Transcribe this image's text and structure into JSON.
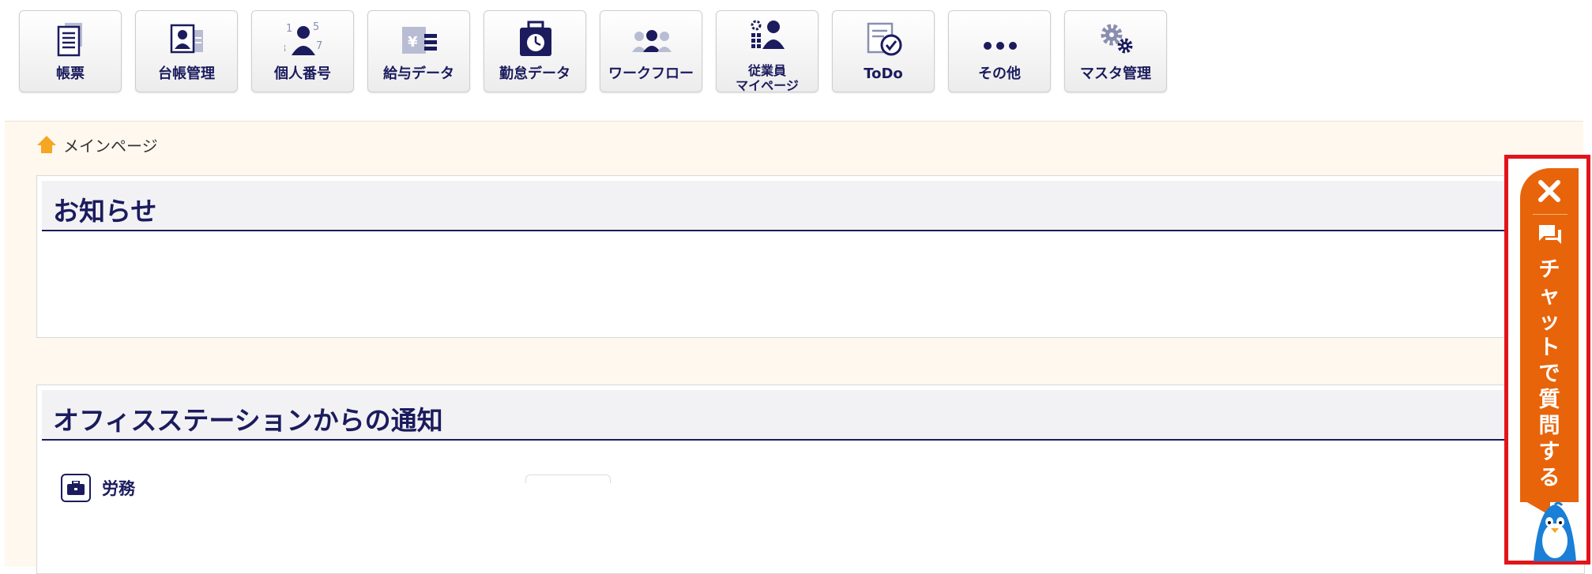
{
  "toolbar": {
    "items": [
      {
        "label": "帳票",
        "icon": "document-list-icon"
      },
      {
        "label": "台帳管理",
        "icon": "id-card-icon"
      },
      {
        "label": "個人番号",
        "icon": "person-number-icon"
      },
      {
        "label": "給与データ",
        "icon": "yen-envelope-icon"
      },
      {
        "label": "勤怠データ",
        "icon": "clock-bag-icon"
      },
      {
        "label": "ワークフロー",
        "icon": "people-flow-icon"
      },
      {
        "label_lines": [
          "従業員",
          "マイページ"
        ],
        "icon": "employee-gear-icon"
      },
      {
        "label": "ToDo",
        "icon": "checklist-icon"
      },
      {
        "label": "その他",
        "icon": "more-dots-icon"
      },
      {
        "label": "マスタ管理",
        "icon": "gears-icon"
      }
    ]
  },
  "breadcrumb": {
    "label": "メインページ",
    "icon": "home-icon"
  },
  "notices_panel": {
    "title": "お知らせ"
  },
  "office_panel": {
    "title": "オフィスステーションからの通知",
    "category": {
      "label": "労務",
      "icon": "briefcase-icon"
    }
  },
  "chat_widget": {
    "text_chars": [
      "チ",
      "ャ",
      "ッ",
      "ト",
      "で",
      "質",
      "問",
      "す",
      "る"
    ],
    "close_icon": "close-icon",
    "bubble_icon": "chat-bubble-icon",
    "mascot_icon": "penguin-mascot-icon",
    "accent_color": "#e8640a",
    "highlight_color": "#e2141b"
  },
  "colors": {
    "primary_navy": "#1b1b5e",
    "background_cream": "#fff8ef",
    "home_icon": "#f5a623"
  }
}
